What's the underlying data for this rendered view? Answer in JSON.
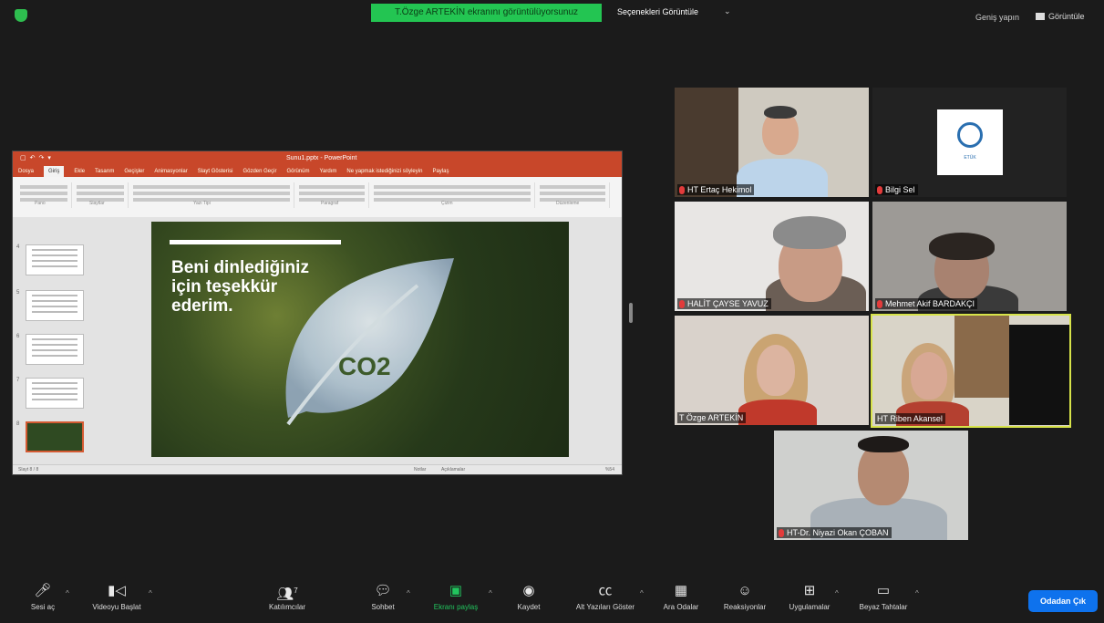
{
  "top_bar": {
    "share_banner": "T.Özge ARTEKİN ekranını görüntülüyorsunuz",
    "view_options": "Seçenekleri Görüntüle",
    "view_options_arrow": "⌄",
    "exit_fullscreen": "Geniş yapın",
    "view": "Görüntüle"
  },
  "shared_screen": {
    "window_title": "Sunu1.pptx - PowerPoint",
    "tabs": [
      "Dosya",
      "Giriş",
      "Ekle",
      "Tasarım",
      "Geçişler",
      "Animasyonlar",
      "Slayt Gösterisi",
      "Gözden Geçir",
      "Görünüm",
      "Yardım",
      "Ne yapmak istediğinizi söyleyin",
      "Paylaş"
    ],
    "ribbon_groups": [
      "Pano",
      "Slaytlar",
      "Yazı Tipi",
      "Paragraf",
      "Çizim",
      "Düzenleme"
    ],
    "slide_numbers": [
      "4",
      "5",
      "6",
      "7",
      "8"
    ],
    "slide_text_lines": [
      "Beni dinlediğiniz",
      "için teşekkür",
      "ederim."
    ],
    "slide_co2": "CO2",
    "status_left": "Slayt 8 / 8",
    "status_notes": "Notlar",
    "status_comments": "Açıklamalar",
    "status_zoom": "%54"
  },
  "participants": [
    {
      "name": "HT Ertaç Hekimol",
      "muted": true
    },
    {
      "name": "Bilgi Sel",
      "muted": true
    },
    {
      "name": "HALİT ÇAYSE YAVUZ",
      "muted": true
    },
    {
      "name": "Mehmet Akif BARDAKÇI",
      "muted": true
    },
    {
      "name": "T Özge ARTEKİN",
      "muted": false
    },
    {
      "name": "HT Riben Akansel",
      "muted": false
    },
    {
      "name": "HT-Dr. Niyazi Okan ÇOBAN",
      "muted": true
    }
  ],
  "logo_caption": "ETÜK",
  "toolbar": {
    "audio": "Sesi aç",
    "video": "Videoyu Başlat",
    "participants": "Katılımcılar",
    "participants_count": "7",
    "chat": "Sohbet",
    "share": "Ekranı paylaş",
    "record": "Kaydet",
    "captions": "Alt Yazıları Göster",
    "breakout": "Ara Odalar",
    "reactions": "Reaksiyonlar",
    "apps": "Uygulamalar",
    "whiteboard": "Beyaz Tahtalar",
    "leave": "Odadan Çık"
  },
  "colors": {
    "share_banner_bg": "#23c552",
    "active_speaker_outline": "#d7e34a",
    "leave_button": "#0e72ed",
    "ppt_accent": "#c8472a"
  }
}
